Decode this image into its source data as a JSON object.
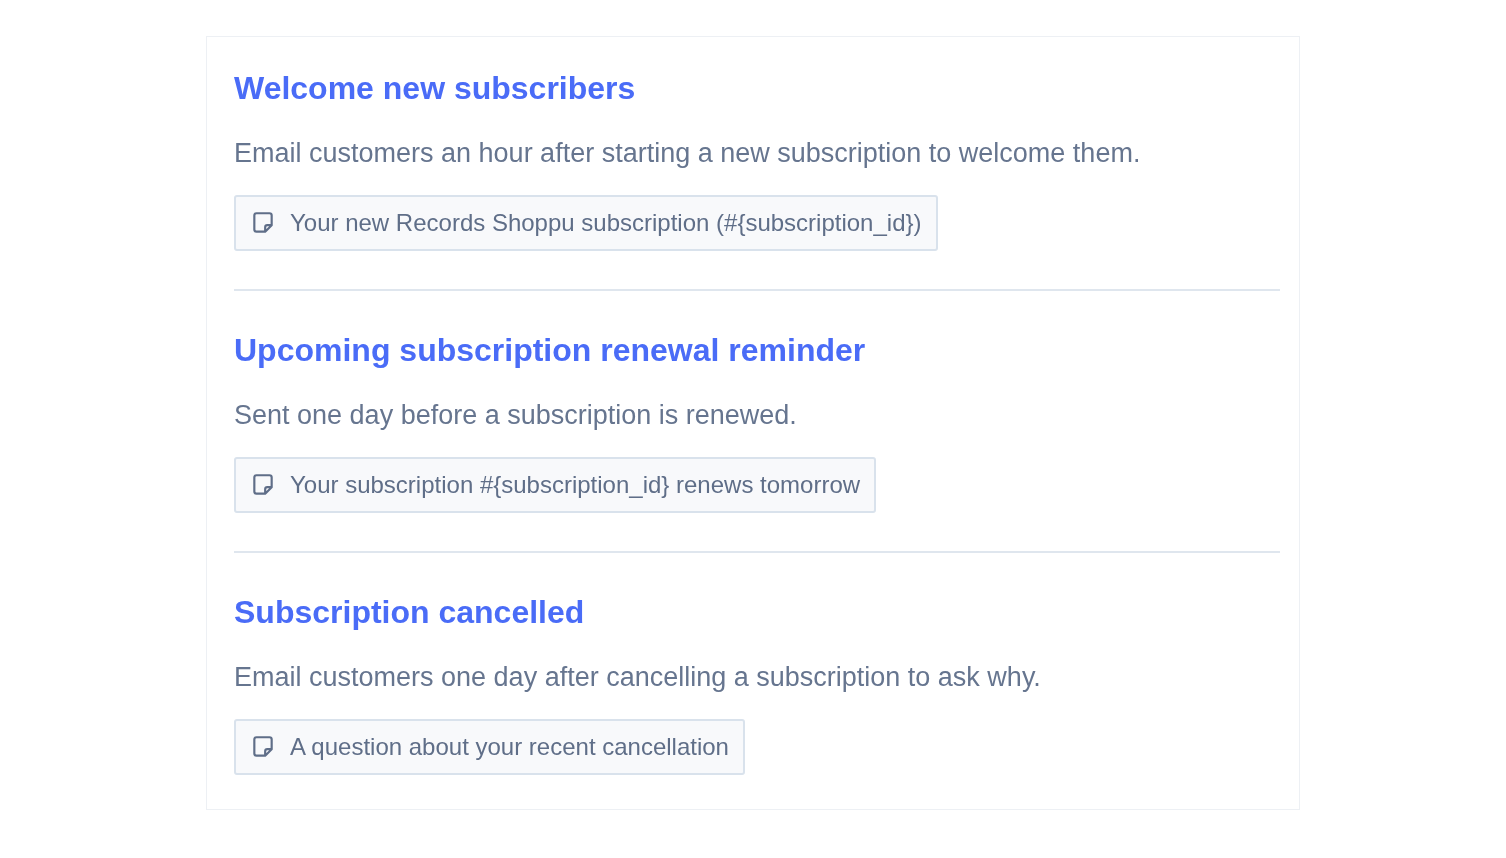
{
  "emails": [
    {
      "title": "Welcome new subscribers",
      "description": "Email customers an hour after starting a new subscription to welcome them.",
      "subject": "Your new Records Shoppu subscription (#{subscription_id})"
    },
    {
      "title": "Upcoming subscription renewal reminder",
      "description": "Sent one day before a subscription is renewed.",
      "subject": "Your subscription #{subscription_id} renews tomorrow"
    },
    {
      "title": "Subscription cancelled",
      "description": "Email customers one day after cancelling a subscription to ask why.",
      "subject": "A question about your recent cancellation"
    }
  ]
}
